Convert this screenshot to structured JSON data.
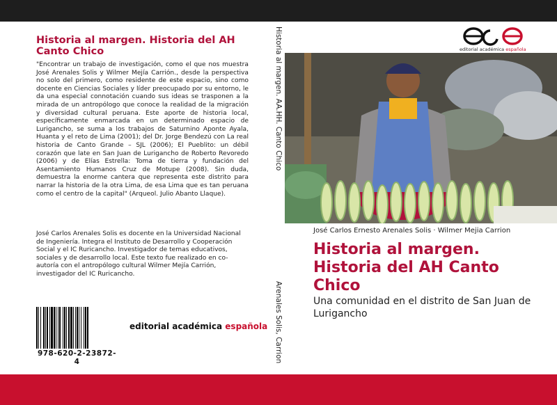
{
  "back": {
    "title": "Historia al margen. Historia del AH Canto Chico",
    "blurb": "\"Encontrar un trabajo de investigación, como el que nos muestra José Arenales Solis y Wilmer Mejía Carrión., desde la perspectiva no solo del primero, como residente de este espacio, sino como docente en Ciencias Sociales y líder preocupado por su entorno, le da una especial connotación cuando sus ideas se trasponen a la mirada de un antropólogo que conoce la realidad de la migración y diversidad cultural peruana. Este aporte de historia local, específicamente enmarcada en un determinado espacio de Lurigancho, se suma a los trabajos de Saturnino Aponte Ayala, Huanta y el reto de Lima (2001); del Dr. Jorge Bendezú con La real historia de Canto Grande – SJL (2006); El Pueblito: un débil corazón que late en San Juan de Lurigancho de Roberto Revoredo (2006) y de Elías Estrella: Toma de tierra y fundación del Asentamiento Humanos Cruz de Motupe (2008). Sin duda, demuestra la enorme cantera que representa este distrito para narrar la historia de la otra Lima, de esa Lima que es tan peruana como el centro de la capital\" (Arqueol. Julio Abanto Llaque).",
    "bio": "José Carlos Arenales Solis es docente en la Universidad Nacional de Ingeniería. Integra el Instituto de Desarrollo y Cooperación Social y el IC Ruricancho. Investigador de temas educativos, sociales y de desarrollo local. Este texto fue realizado en co-autoría con el antropólogo cultural Wilmer Mejía Carrión, investigador del IC Ruricancho.",
    "isbn": "978-620-2-23872-4",
    "publisher_main": "editorial académica ",
    "publisher_accent": "española"
  },
  "spine": {
    "title": "Historia al margen. AA.HH. Canto Chico",
    "authors": "Arenales Solis, Carrion"
  },
  "front": {
    "logo_text_main": "editorial académica ",
    "logo_text_accent": "española",
    "authors": "José Carlos Ernesto Arenales Solis · Wilmer Mejia Carrion",
    "title": "Historia al margen. Historia del AH Canto Chico",
    "subtitle": "Una comunidad en el distrito de San Juan de Lurigancho"
  },
  "colors": {
    "top_band": "#1e1e1e",
    "bottom_band": "#c8102e",
    "title_accent": "#b0123b"
  }
}
